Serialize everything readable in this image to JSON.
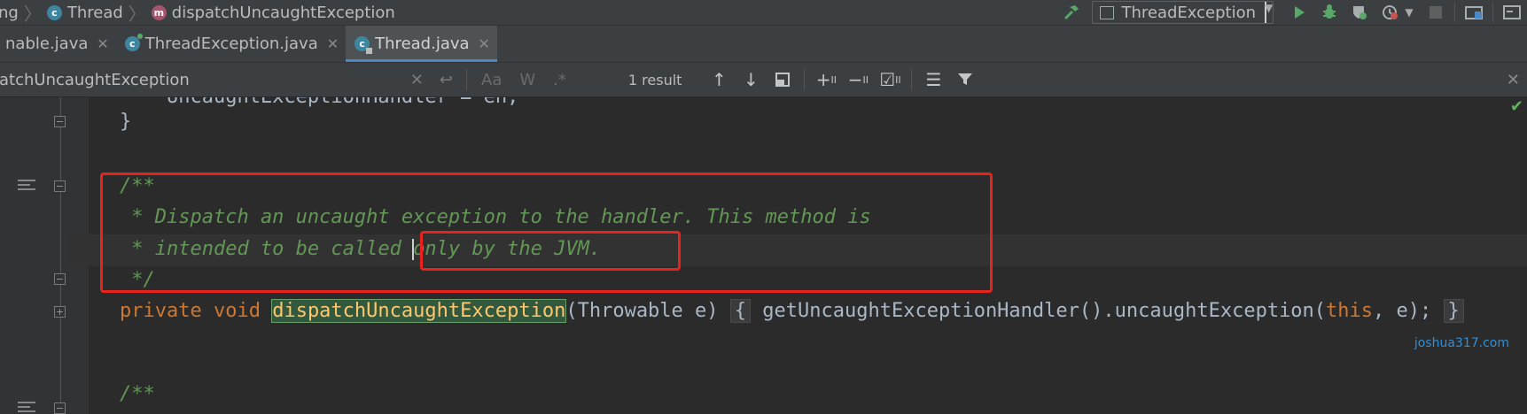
{
  "breadcrumb": {
    "items": [
      {
        "label": "ng",
        "icon": ""
      },
      {
        "label": "Thread",
        "icon": "class-icon"
      },
      {
        "label": "dispatchUncaughtException",
        "icon": "method-icon"
      }
    ],
    "class_icon_letter": "c",
    "method_icon_letter": "m"
  },
  "toolbar": {
    "run_config": "ThreadException"
  },
  "tabs": [
    {
      "label": "nable.java",
      "active": false
    },
    {
      "label": "ThreadException.java",
      "active": false
    },
    {
      "label": "Thread.java",
      "active": true
    }
  ],
  "search": {
    "query": "atchUncaughtException",
    "results_text": "1 result",
    "options": {
      "case": "Aa",
      "words": "W",
      "regex": ".*"
    }
  },
  "code": {
    "line_prev": "    UncaughtExceptionHandler = eh;",
    "brace_close": "}",
    "doc_open": "/**",
    "doc_line1": " * Dispatch an uncaught exception to the handler. This method is",
    "doc_line2_a": " * intended to be called ",
    "doc_line2_b": "only by the JVM.",
    "doc_close": " */",
    "method_kw1": "private",
    "method_kw2": "void",
    "method_name": "dispatchUncaughtException",
    "method_params": "(Throwable e)",
    "fold_open": "{",
    "method_body": "getUncaughtExceptionHandler().uncaughtException(",
    "method_this": "this",
    "method_end": ", e);",
    "fold_close": "}",
    "doc_next": "/**"
  },
  "watermark": "joshua317.com",
  "colors": {
    "annotation_red": "#e8231b",
    "doc_comment": "#629755",
    "keyword": "#cc7832",
    "method_highlight": "#ffc66d"
  }
}
